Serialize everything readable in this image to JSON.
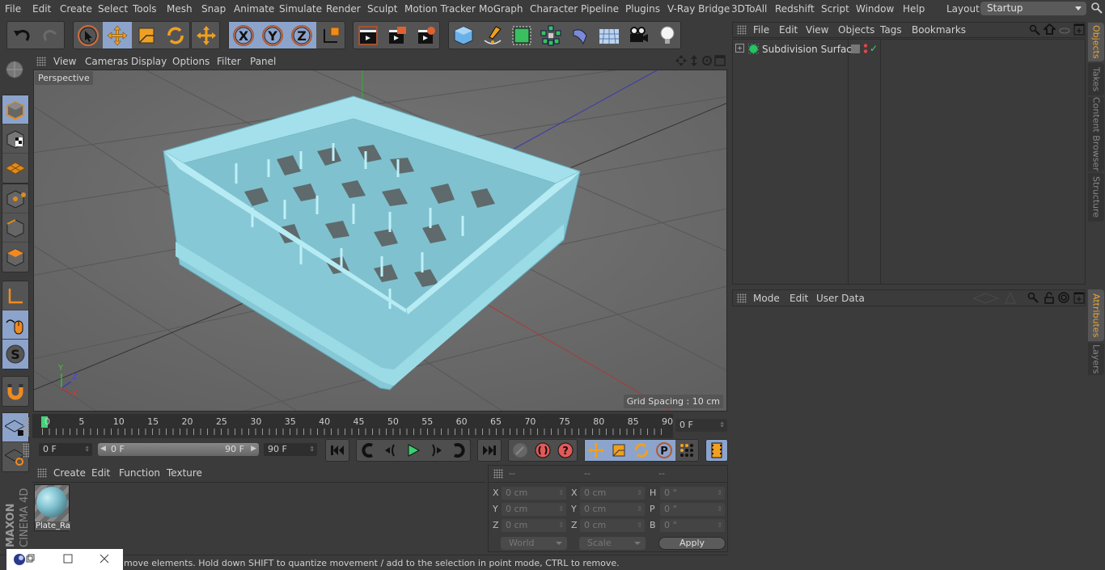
{
  "menubar": {
    "items": [
      "File",
      "Edit",
      "Create",
      "Select",
      "Tools",
      "Mesh",
      "Snap",
      "Animate",
      "Simulate",
      "Render",
      "Sculpt",
      "Motion Tracker",
      "MoGraph",
      "Character",
      "Pipeline",
      "Plugins",
      "V-Ray Bridge",
      "3DToAll",
      "Redshift",
      "Script",
      "Window",
      "Help"
    ],
    "layout_label": "Layout:",
    "layout_value": "Startup"
  },
  "toolbar": {
    "icons": [
      "undo-icon",
      "redo-icon",
      "live-selection-icon",
      "move-icon",
      "scale-icon",
      "rotate-icon",
      "recent-tool-icon",
      "x-axis-lock-icon",
      "y-axis-lock-icon",
      "z-axis-lock-icon",
      "coordinate-system-icon",
      "render-view-icon",
      "render-picture-viewer-icon",
      "render-settings-icon",
      "cube-icon",
      "pen-spline-icon",
      "subdivision-surface-icon",
      "cloner-icon",
      "deformer-icon",
      "floor-icon",
      "camera-icon",
      "light-icon"
    ]
  },
  "viewport": {
    "menu": [
      "View",
      "Cameras",
      "Display",
      "Options",
      "Filter",
      "Panel"
    ],
    "camera_label": "Perspective",
    "grid_spacing": "Grid Spacing : 10 cm",
    "axis_labels": {
      "x": "X",
      "y": "Y",
      "z": "Z"
    },
    "model_color": "#8fd2df"
  },
  "timeline": {
    "ticks": [
      "0",
      "5",
      "10",
      "15",
      "20",
      "25",
      "30",
      "35",
      "40",
      "45",
      "50",
      "55",
      "60",
      "65",
      "70",
      "75",
      "80",
      "85",
      "90"
    ],
    "current_frame": "0 F",
    "start_field": "0 F",
    "range_start": "0 F",
    "range_end": "90 F",
    "end_field": "90 F"
  },
  "material_manager": {
    "menu": [
      "Create",
      "Edit",
      "Function",
      "Texture"
    ],
    "materials": [
      {
        "name": "Plate_Ra"
      }
    ]
  },
  "coordinates": {
    "headers": [
      "--",
      "--",
      "--"
    ],
    "rows": [
      {
        "l1": "X",
        "v1": "0 cm",
        "l2": "X",
        "v2": "0 cm",
        "l3": "H",
        "v3": "0 °"
      },
      {
        "l1": "Y",
        "v1": "0 cm",
        "l2": "Y",
        "v2": "0 cm",
        "l3": "P",
        "v3": "0 °"
      },
      {
        "l1": "Z",
        "v1": "0 cm",
        "l2": "Z",
        "v2": "0 cm",
        "l3": "B",
        "v3": "0 °"
      }
    ],
    "mode_dropdown": "World",
    "scale_dropdown": "Scale",
    "apply_label": "Apply"
  },
  "status_text": "move elements. Hold down SHIFT to quantize movement / add to the selection in point mode, CTRL to remove.",
  "branding": "MAXON CINEMA 4D",
  "object_manager": {
    "menu": [
      "File",
      "Edit",
      "View",
      "Objects",
      "Tags",
      "Bookmarks"
    ],
    "objects": [
      {
        "name": "Subdivision Surface"
      }
    ]
  },
  "attribute_manager": {
    "menu": [
      "Mode",
      "Edit",
      "User Data"
    ]
  },
  "side_tabs_top": [
    {
      "label": "Objects",
      "active": true
    },
    {
      "label": "Takes",
      "active": false
    },
    {
      "label": "Content Browser",
      "active": false
    },
    {
      "label": "Structure",
      "active": false
    }
  ],
  "side_tabs_bottom": [
    {
      "label": "Attributes",
      "active": true
    },
    {
      "label": "Layers",
      "active": false
    }
  ]
}
